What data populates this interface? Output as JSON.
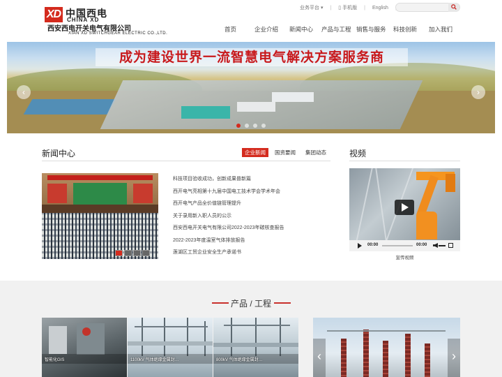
{
  "brand": {
    "mark": "XD",
    "name_cn": "中国西电",
    "name_en": "CHINA XD",
    "company_cn": "西安西电开关电气有限公司",
    "company_en": "XIAN XD SWITCHGEAR ELECTRIC CO.,LTD."
  },
  "topbar": {
    "business_platform": "业务平台",
    "mobile": "手机版",
    "english": "English",
    "search_placeholder": ""
  },
  "nav": [
    "首页",
    "企业介绍",
    "新闻中心",
    "产品与工程",
    "销售与服务",
    "科技创新",
    "加入我们"
  ],
  "banner": {
    "slogan": "成为建设世界一流智慧电气解决方案服务商",
    "prev": "‹",
    "next": "›",
    "slides": 4,
    "active_slide": 1
  },
  "news": {
    "title": "新闻中心",
    "tabs": [
      "企业新闻",
      "国资要闻",
      "集团动态"
    ],
    "active_tab": 0,
    "items": [
      "科技项目验收成功，创新成果普新篇",
      "西开电气亮相第十九届中国电工技术学会学术年会",
      "西开电气产品全价值链管理提升",
      "关于录用新入职人员的公示",
      "西安西电开关电气有限公司2022-2023年碳核查报告",
      "2022-2023年度温室气体排放报告",
      "莲湖区工贸企业安全生产承诺书"
    ]
  },
  "video": {
    "title": "视频",
    "current_time": "00:00",
    "duration": "00:00",
    "caption": "宣传视频"
  },
  "products": {
    "title": "产品 / 工程",
    "items": [
      "智能化GIS",
      "1100kV 气体绝缘金属封…",
      "800kV 气体绝缘金属封…"
    ],
    "project_prev": "‹",
    "project_next": "›"
  },
  "colors": {
    "brand_red": "#d42b1e",
    "banner_title_red": "#c8191c",
    "section_bg": "#f1f1f1"
  }
}
